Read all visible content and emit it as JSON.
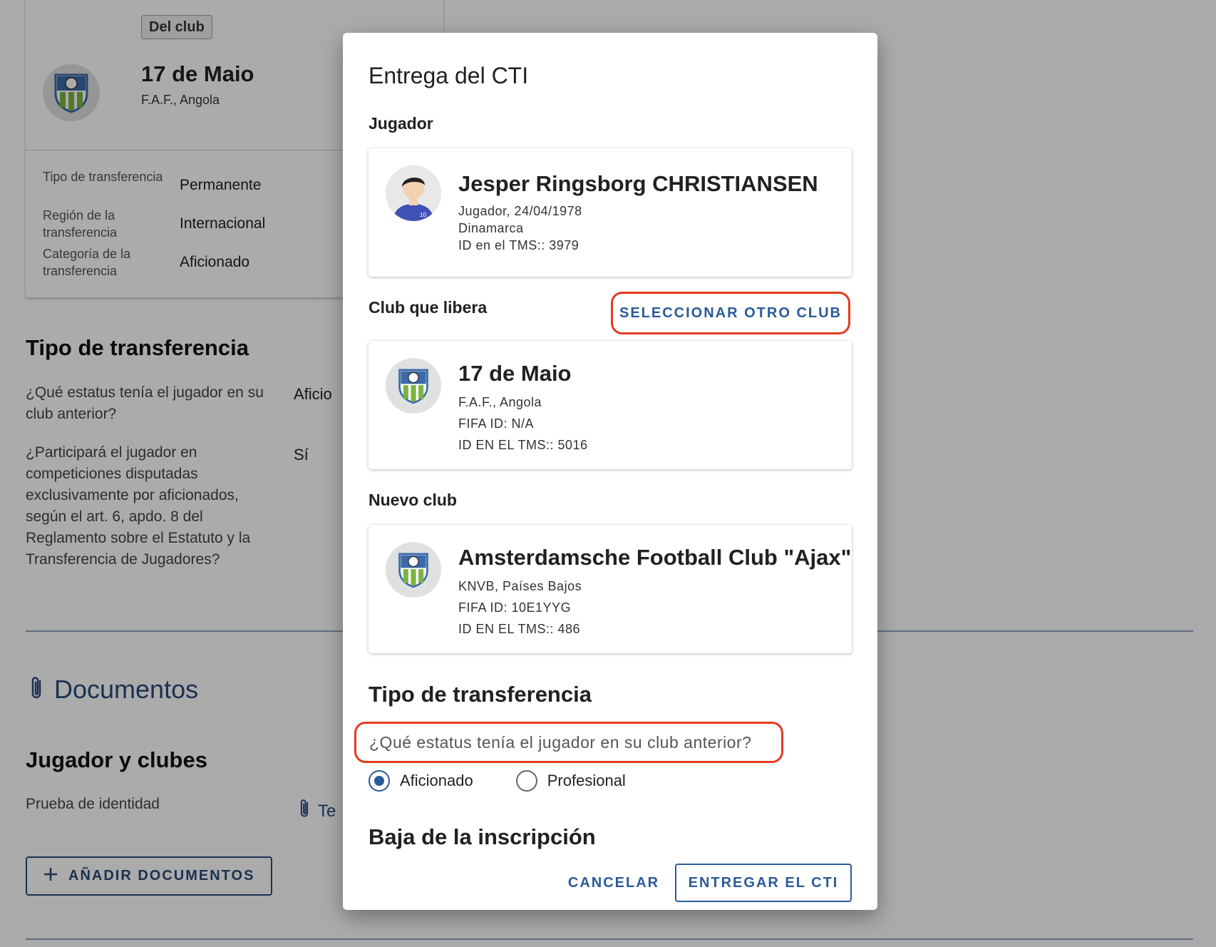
{
  "background": {
    "club_chip": "Del club",
    "club_name": "17 de Maio",
    "club_sub": "F.A.F., Angola",
    "details": [
      {
        "label": "Tipo de transferencia",
        "value": "Permanente"
      },
      {
        "label": "Región de la transferencia",
        "value": "Internacional"
      },
      {
        "label": "Categoría de la transferencia",
        "value": "Aficionado"
      }
    ],
    "transfer_type_title": "Tipo de transferencia",
    "questions": [
      {
        "q": "¿Qué estatus tenía el jugador en su club anterior?",
        "a": "Aficio"
      },
      {
        "q": "¿Participará el jugador en competiciones disputadas exclusivamente por aficionados, según el art. 6, apdo. 8 del Reglamento sobre el Estatuto y la Transferencia de Jugadores?",
        "a": "Sí"
      }
    ],
    "documents_title": "Documentos",
    "players_clubs_title": "Jugador y clubes",
    "identity_label": "Prueba de identidad",
    "identity_link": "Te",
    "add_documents": "AÑADIR DOCUMENTOS"
  },
  "dialog": {
    "title": "Entrega del CTI",
    "player_label": "Jugador",
    "player": {
      "name": "Jesper Ringsborg CHRISTIANSEN",
      "line1": "Jugador, 24/04/1978",
      "line2": "Dinamarca",
      "line3": "ID en el TMS:: 3979",
      "shirt_number": "10"
    },
    "releasing_label": "Club que libera",
    "select_other_club": "SELECCIONAR OTRO CLUB",
    "releasing_club": {
      "name": "17 de Maio",
      "line1": "F.A.F., Angola",
      "line2": "FIFA ID: N/A",
      "line3": "ID EN EL TMS:: 5016"
    },
    "new_club_label": "Nuevo club",
    "new_club": {
      "name": "Amsterdamsche Football Club \"Ajax\"",
      "line1": "KNVB, Países Bajos",
      "line2": "FIFA ID: 10E1YYG",
      "line3": "ID EN EL TMS:: 486"
    },
    "transfer_type_title": "Tipo de transferencia",
    "status_question": "¿Qué estatus tenía el jugador en su club anterior?",
    "options": [
      {
        "label": "Aficionado",
        "selected": true
      },
      {
        "label": "Profesional",
        "selected": false
      }
    ],
    "deregistration_title": "Baja de la inscripción",
    "cancel": "CANCELAR",
    "submit": "ENTREGAR EL CTI"
  },
  "colors": {
    "accent": "#2a5a9a",
    "highlight": "#e53a22",
    "overlay": "rgba(0,0,0,0.33)"
  }
}
